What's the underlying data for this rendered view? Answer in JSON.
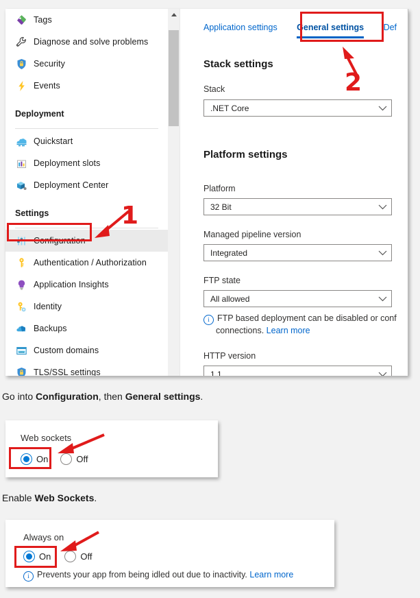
{
  "sidebar": {
    "items": [
      {
        "label": "Tags",
        "icon": "tag-icon"
      },
      {
        "label": "Diagnose and solve problems",
        "icon": "wrench-icon"
      },
      {
        "label": "Security",
        "icon": "shield-lock-icon"
      },
      {
        "label": "Events",
        "icon": "lightning-bolt-icon"
      }
    ],
    "group_deployment": {
      "header": "Deployment",
      "items": [
        {
          "label": "Quickstart",
          "icon": "quickstart-icon"
        },
        {
          "label": "Deployment slots",
          "icon": "deployment-slots-icon"
        },
        {
          "label": "Deployment Center",
          "icon": "deployment-center-icon"
        }
      ]
    },
    "group_settings": {
      "header": "Settings",
      "items": [
        {
          "label": "Configuration",
          "icon": "sliders-icon",
          "selected": true
        },
        {
          "label": "Authentication / Authorization",
          "icon": "key-icon"
        },
        {
          "label": "Application Insights",
          "icon": "lightbulb-icon"
        },
        {
          "label": "Identity",
          "icon": "key-badge-icon"
        },
        {
          "label": "Backups",
          "icon": "cloud-backup-icon"
        },
        {
          "label": "Custom domains",
          "icon": "www-card-icon"
        },
        {
          "label": "TLS/SSL settings",
          "icon": "shield-lock-icon"
        }
      ]
    }
  },
  "content": {
    "tabs": [
      {
        "label": "Application settings",
        "active": false
      },
      {
        "label": "General settings",
        "active": true
      },
      {
        "label": "Def",
        "active": false
      }
    ],
    "stack_section": {
      "title": "Stack settings",
      "stack_label": "Stack",
      "stack_value": ".NET Core"
    },
    "platform_section": {
      "title": "Platform settings",
      "platform_label": "Platform",
      "platform_value": "32 Bit",
      "pipeline_label": "Managed pipeline version",
      "pipeline_value": "Integrated",
      "ftp_label": "FTP state",
      "ftp_value": "All allowed",
      "ftp_hint": "FTP based deployment can be disabled or conf",
      "ftp_hint2": "connections.",
      "ftp_hint_link": "Learn more",
      "http_label": "HTTP version",
      "http_value": "1.1"
    }
  },
  "captions": {
    "step1_pre": "Go into ",
    "step1_b1": "Configuration",
    "step1_mid": ", then ",
    "step1_b2": "General settings",
    "step1_post": ".",
    "step2_pre": "Enable ",
    "step2_b1": "Web Sockets",
    "step2_post": "."
  },
  "websockets_panel": {
    "label": "Web sockets",
    "on_label": "On",
    "off_label": "Off",
    "selected": "On"
  },
  "alwayson_panel": {
    "label": "Always on",
    "on_label": "On",
    "off_label": "Off",
    "selected": "On",
    "hint": "Prevents your app from being idled out due to inactivity.",
    "hint_link": "Learn more"
  },
  "annotations": {
    "step_one_number": "1",
    "step_two_number": "2",
    "highlight_color": "#e01b1b",
    "accent_color": "#0078d4",
    "link_color": "#0066cc"
  }
}
